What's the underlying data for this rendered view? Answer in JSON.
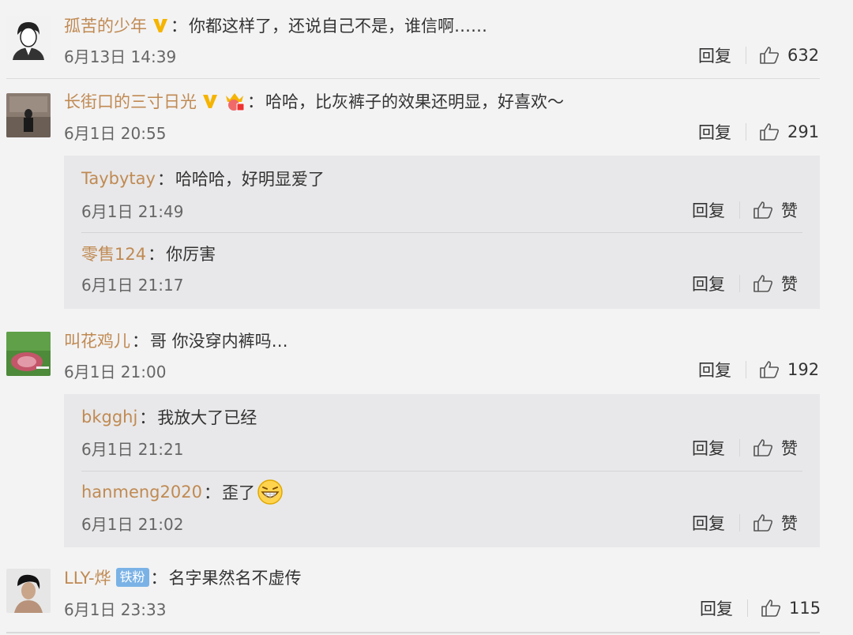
{
  "comments": [
    {
      "username": "孤苦的少年",
      "text": "你都这样了，还说自己不是，谁信啊……",
      "time": "6月13日 14:39",
      "reply": "回复",
      "likes": "632"
    },
    {
      "username": "长街口的三寸日光",
      "text": "哈哈，比灰裤子的效果还明显，好喜欢～",
      "time": "6月1日 20:55",
      "reply": "回复",
      "likes": "291",
      "subreplies": [
        {
          "username": "Taybytay",
          "text": "哈哈哈，好明显爱了",
          "time": "6月1日 21:49",
          "reply": "回复",
          "like": "赞"
        },
        {
          "username": "零售124",
          "text": "你厉害",
          "time": "6月1日 21:17",
          "reply": "回复",
          "like": "赞"
        }
      ]
    },
    {
      "username": "叫花鸡儿",
      "text": "哥 你没穿内裤吗…",
      "time": "6月1日 21:00",
      "reply": "回复",
      "likes": "192",
      "subreplies": [
        {
          "username": "bkgghj",
          "text": "我放大了已经",
          "time": "6月1日 21:21",
          "reply": "回复",
          "like": "赞"
        },
        {
          "username": "hanmeng2020",
          "text": "歪了",
          "time": "6月1日 21:02",
          "reply": "回复",
          "like": "赞"
        }
      ]
    },
    {
      "username": "LLY-烨",
      "badge": "铁粉",
      "text": "名字果然名不虚传",
      "time": "6月1日 23:33",
      "reply": "回复",
      "likes": "115"
    }
  ],
  "colors": {
    "username": "#c08a52",
    "background": "#f3f3f4",
    "subbox": "#e8e8ea",
    "vip_gold": "#f5b400",
    "fan_badge": "#7ab2e6"
  }
}
